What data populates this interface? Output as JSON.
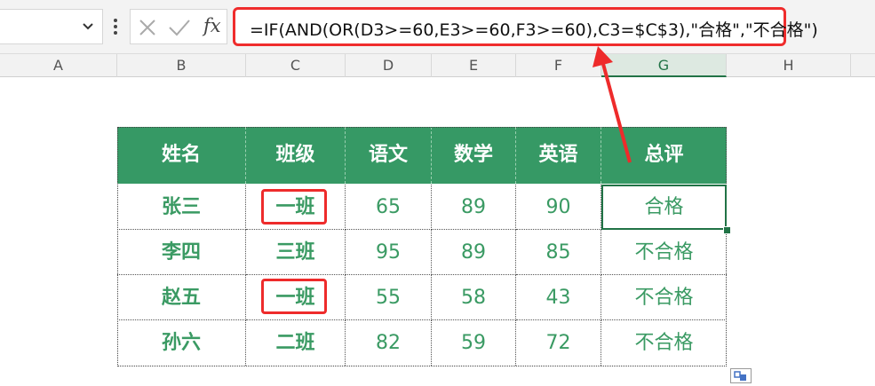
{
  "formula_bar": {
    "name_box_value": "",
    "fx_label": "fx",
    "formula": "=IF(AND(OR(D3>=60,E3>=60,F3>=60),C3=$C$3),\"合格\",\"不合格\")"
  },
  "columns": [
    "A",
    "B",
    "C",
    "D",
    "E",
    "F",
    "G",
    "H"
  ],
  "selected_column": "G",
  "table": {
    "headers": [
      "姓名",
      "班级",
      "语文",
      "数学",
      "英语",
      "总评"
    ],
    "rows": [
      [
        "张三",
        "一班",
        "65",
        "89",
        "90",
        "合格"
      ],
      [
        "李四",
        "三班",
        "95",
        "89",
        "85",
        "不合格"
      ],
      [
        "赵五",
        "一班",
        "55",
        "58",
        "43",
        "不合格"
      ],
      [
        "孙六",
        "二班",
        "82",
        "59",
        "72",
        "不合格"
      ]
    ]
  },
  "colors": {
    "header_bg": "#369965",
    "data_text": "#3a9a63",
    "highlight": "#ee2b2b",
    "selection": "#217346"
  },
  "icons": [
    "chevron-down-icon",
    "more-vertical-icon",
    "cancel-x-icon",
    "check-icon",
    "function-fx-icon",
    "quick-analysis-icon"
  ]
}
